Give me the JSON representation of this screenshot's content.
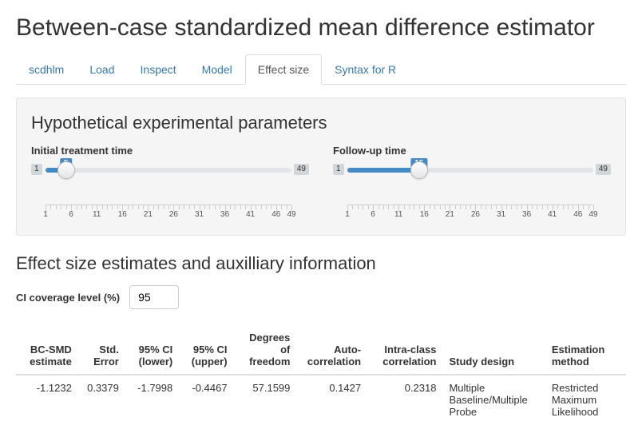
{
  "page_title": "Between-case standardized mean difference estimator",
  "tabs": [
    {
      "label": "scdhlm",
      "active": false
    },
    {
      "label": "Load",
      "active": false
    },
    {
      "label": "Inspect",
      "active": false
    },
    {
      "label": "Model",
      "active": false
    },
    {
      "label": "Effect size",
      "active": true
    },
    {
      "label": "Syntax for R",
      "active": false
    }
  ],
  "params": {
    "heading": "Hypothetical experimental parameters",
    "sliders": {
      "initial": {
        "label": "Initial treatment time",
        "min": 1,
        "max": 49,
        "value": 5
      },
      "followup": {
        "label": "Follow-up time",
        "min": 1,
        "max": 49,
        "value": 15
      }
    },
    "tick_labels": [
      1,
      6,
      11,
      16,
      21,
      26,
      31,
      36,
      41,
      46,
      49
    ]
  },
  "estimates": {
    "heading": "Effect size estimates and auxilliary information",
    "ci_label": "CI coverage level (%)",
    "ci_value": "95",
    "columns": [
      "BC-SMD estimate",
      "Std. Error",
      "95% CI (lower)",
      "95% CI (upper)",
      "Degrees of freedom",
      "Auto-correlation",
      "Intra-class correlation",
      "Study design",
      "Estimation method"
    ],
    "row": {
      "bc_smd": "-1.1232",
      "std_error": "0.3379",
      "ci_lower": "-1.7998",
      "ci_upper": "-0.4467",
      "dof": "57.1599",
      "autocorr": "0.1427",
      "icc": "0.2318",
      "design": "Multiple Baseline/Multiple Probe",
      "method": "Restricted Maximum Likelihood"
    }
  }
}
